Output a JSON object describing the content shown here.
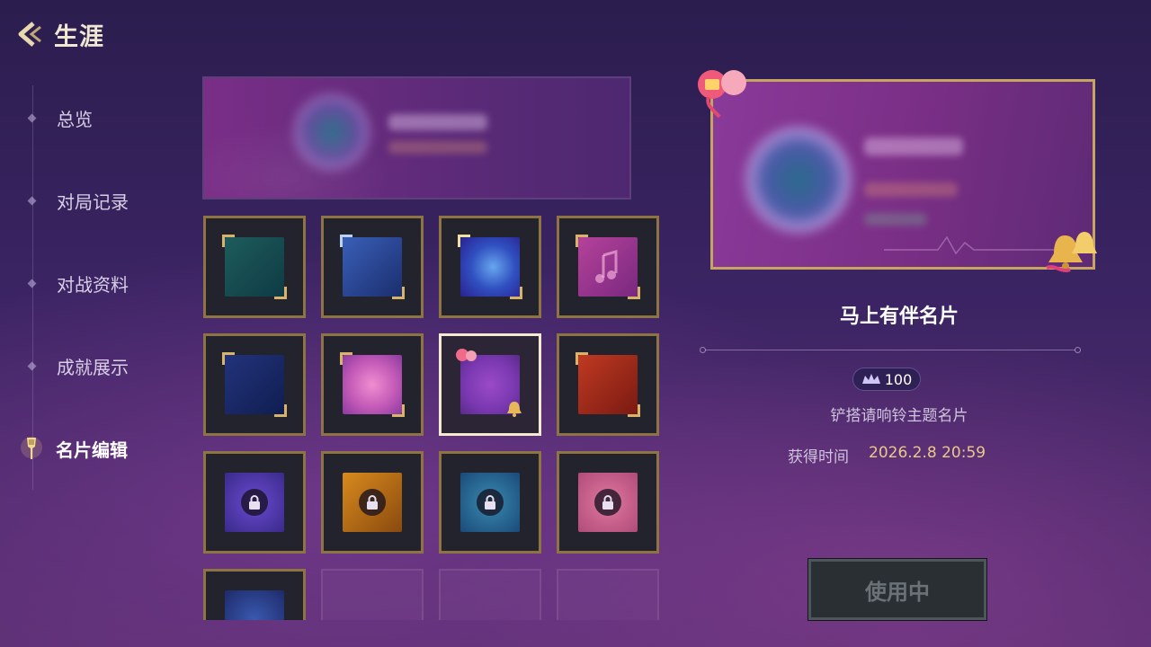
{
  "header": {
    "title": "生涯",
    "back_icon": "chevron-left-icon"
  },
  "sidebar": {
    "items": [
      {
        "label": "总览",
        "active": false
      },
      {
        "label": "对局记录",
        "active": false
      },
      {
        "label": "对战资料",
        "active": false
      },
      {
        "label": "成就展示",
        "active": false
      },
      {
        "label": "名片编辑",
        "active": true,
        "icon": "spatula-icon"
      }
    ]
  },
  "grid": {
    "cards": [
      {
        "theme": "teal",
        "state": "owned"
      },
      {
        "theme": "blue-ornate",
        "state": "owned"
      },
      {
        "theme": "cosmic-blue",
        "state": "owned"
      },
      {
        "theme": "magenta-music",
        "state": "owned"
      },
      {
        "theme": "navy",
        "state": "owned"
      },
      {
        "theme": "pink-creature",
        "state": "owned"
      },
      {
        "theme": "purple-bell",
        "state": "selected"
      },
      {
        "theme": "red-flame",
        "state": "owned"
      },
      {
        "theme": "violet",
        "state": "locked"
      },
      {
        "theme": "amber",
        "state": "locked"
      },
      {
        "theme": "ocean",
        "state": "locked"
      },
      {
        "theme": "rose",
        "state": "locked"
      },
      {
        "theme": "dark-blue",
        "state": "locked"
      },
      {
        "theme": "empty",
        "state": "empty"
      },
      {
        "theme": "empty",
        "state": "empty"
      },
      {
        "theme": "empty",
        "state": "empty"
      }
    ]
  },
  "detail": {
    "name": "马上有伴名片",
    "price": "100",
    "price_icon": "crown-currency-icon",
    "description": "铲搭请响铃主题名片",
    "obtain_label": "获得时间",
    "obtain_time": "2026.2.8  20:59",
    "use_button_label": "使用中"
  },
  "colors": {
    "accent_gold": "#c6a561",
    "selected_border": "#f4ead0",
    "time_text": "#e9c98a"
  }
}
